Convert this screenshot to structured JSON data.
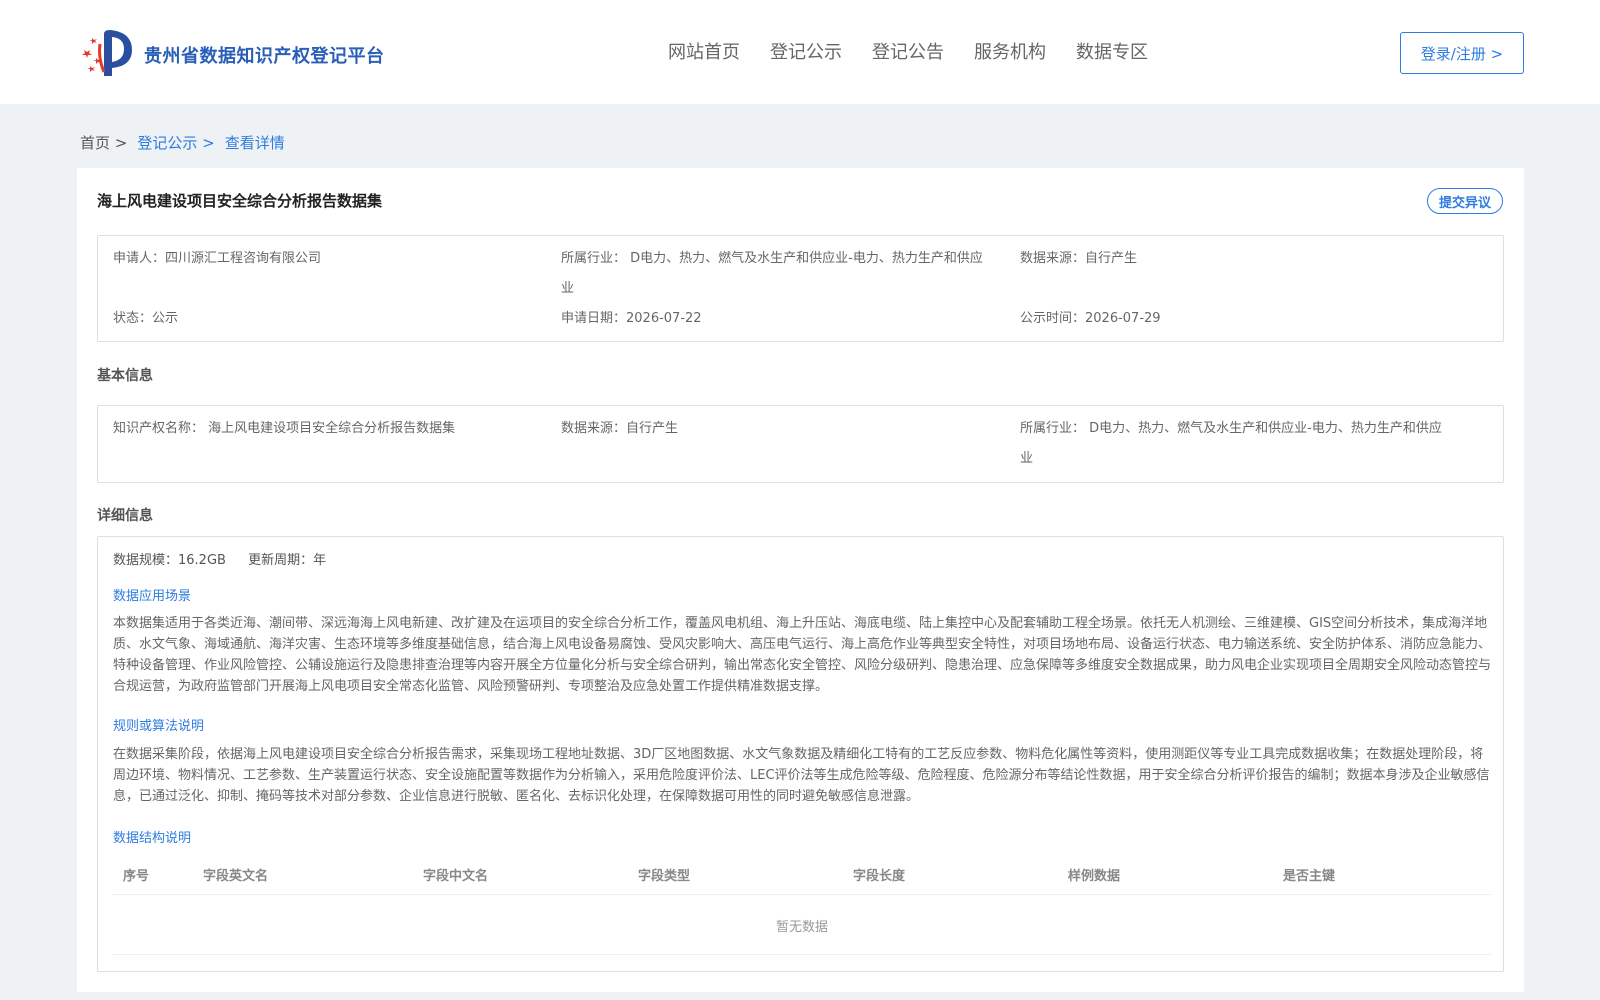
{
  "header": {
    "site_title": "贵州省数据知识产权登记平台",
    "nav": [
      "网站首页",
      "登记公示",
      "登记公告",
      "服务机构",
      "数据专区"
    ],
    "login_label": "登录/注册 >",
    "colors": {
      "brand": "#2a5fb8",
      "accent": "#2d7ce0",
      "logo_red": "#e23b2e"
    }
  },
  "breadcrumb": {
    "home": "首页 >",
    "public": "登记公示 >",
    "current": "查看详情"
  },
  "page": {
    "title": "海上风电建设项目安全综合分析报告数据集",
    "objection_label": "提交异议"
  },
  "summary": {
    "applicant": "申请人：四川源汇工程咨询有限公司",
    "industry_a": "所属行业： D电力、热力、燃气及水生产和供应业-电力、热力生产和供应",
    "industry_b": "业",
    "source": "数据来源：自行产生",
    "status": "状态：公示",
    "apply_date": "申请日期：2026-07-22",
    "publish_date": "公示时间：2026-07-29"
  },
  "basic": {
    "heading": "基本信息",
    "ip_name": "知识产权名称： 海上风电建设项目安全综合分析报告数据集",
    "source": "数据来源：自行产生",
    "industry_a": "所属行业： D电力、热力、燃气及水生产和供应业-电力、热力生产和供应",
    "industry_b": "业"
  },
  "detail": {
    "heading": "详细信息",
    "scale": "数据规模：16.2GB",
    "cycle": "更新周期：年",
    "scenario_heading": "数据应用场景",
    "scenario_text": "本数据集适用于各类近海、潮间带、深远海海上风电新建、改扩建及在运项目的安全综合分析工作，覆盖风电机组、海上升压站、海底电缆、陆上集控中心及配套辅助工程全场景。依托无人机测绘、三维建模、GIS空间分析技术，集成海洋地质、水文气象、海域通航、海洋灾害、生态环境等多维度基础信息，结合海上风电设备易腐蚀、受风灾影响大、高压电气运行、海上高危作业等典型安全特性，对项目场地布局、设备运行状态、电力输送系统、安全防护体系、消防应急能力、特种设备管理、作业风险管控、公辅设施运行及隐患排查治理等内容开展全方位量化分析与安全综合研判，输出常态化安全管控、风险分级研判、隐患治理、应急保障等多维度安全数据成果，助力风电企业实现项目全周期安全风险动态管控与合规运营，为政府监管部门开展海上风电项目安全常态化监管、风险预警研判、专项整治及应急处置工作提供精准数据支撑。",
    "algorithm_heading": "规则或算法说明",
    "algorithm_text": "在数据采集阶段，依据海上风电建设项目安全综合分析报告需求，采集现场工程地址数据、3D厂区地图数据、水文气象数据及精细化工特有的工艺反应参数、物料危化属性等资料，使用测距仪等专业工具完成数据收集；在数据处理阶段，将周边环境、物料情况、工艺参数、生产装置运行状态、安全设施配置等数据作为分析输入，采用危险度评价法、LEC评价法等生成危险等级、危险程度、危险源分布等结论性数据，用于安全综合分析评价报告的编制；数据本身涉及企业敏感信息，已通过泛化、抑制、掩码等技术对部分参数、企业信息进行脱敏、匿名化、去标识化处理，在保障数据可用性的同时避免敏感信息泄露。",
    "structure_heading": "数据结构说明",
    "table_headers": [
      "序号",
      "字段英文名",
      "字段中文名",
      "字段类型",
      "字段长度",
      "样例数据",
      "是否主键"
    ],
    "empty_text": "暂无数据"
  }
}
